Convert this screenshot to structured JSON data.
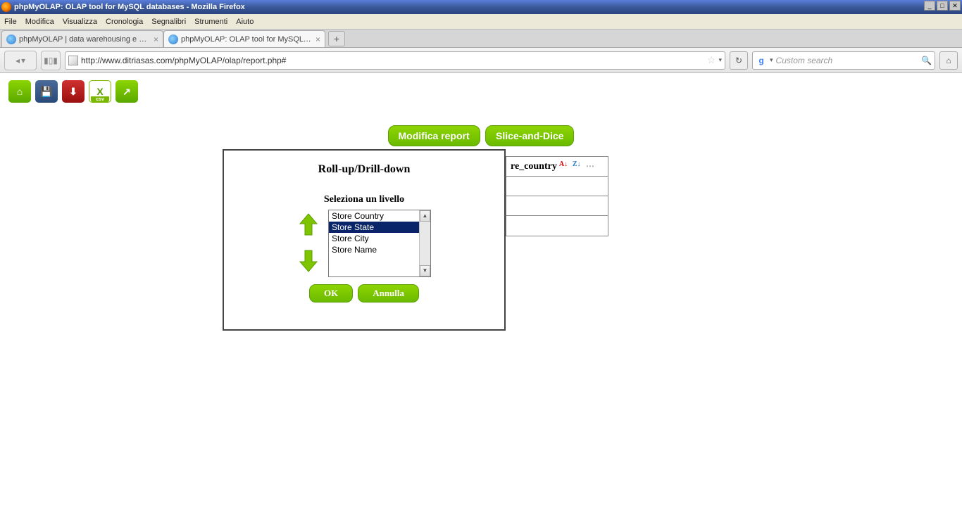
{
  "window": {
    "title": "phpMyOLAP: OLAP tool for MySQL databases - Mozilla Firefox"
  },
  "menu": {
    "items": [
      "File",
      "Modifica",
      "Visualizza",
      "Cronologia",
      "Segnalibri",
      "Strumenti",
      "Aiuto"
    ]
  },
  "tabs": {
    "items": [
      {
        "label": "phpMyOLAP | data warehousing e analisi ..."
      },
      {
        "label": "phpMyOLAP: OLAP tool for MySQL datab..."
      }
    ],
    "new_tab": "+"
  },
  "url_bar": {
    "history_arrow": "▾",
    "url": "http://www.ditriasas.com/phpMyOLAP/olap/report.php#",
    "search_engine_letter": "g",
    "search_arrow": "▾",
    "search_placeholder": "Custom search"
  },
  "app_toolbar": {
    "home_glyph": "⌂",
    "save_glyph": "💾",
    "pdf_glyph": "⬇",
    "csv_glyph": "X",
    "csv_label": "csv",
    "share_glyph": "↗"
  },
  "action_buttons": {
    "modify_report": "Modifica report",
    "slice_dice": "Slice-and-Dice"
  },
  "bg_table": {
    "header_fragment": "re_country",
    "sort_az": "A↓",
    "sort_za": "Z↓",
    "edit_glyph": "⋯"
  },
  "dialog": {
    "title": "Roll-up/Drill-down",
    "subtitle": "Seleziona un livello",
    "options": [
      "Store Country",
      "Store State",
      "Store City",
      "Store Name"
    ],
    "selected_index": 1,
    "ok": "OK",
    "cancel": "Annulla",
    "up_glyph": "▲",
    "down_glyph": "▼"
  }
}
